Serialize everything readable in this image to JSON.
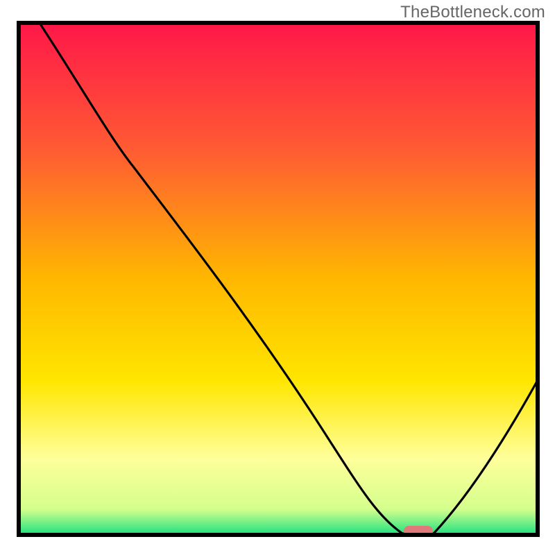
{
  "watermark": "TheBottleneck.com",
  "chart_data": {
    "type": "line",
    "title": "",
    "xlabel": "",
    "ylabel": "",
    "x_range": [
      0,
      100
    ],
    "y_range": [
      0,
      100
    ],
    "background_gradient": [
      {
        "stop": 0.0,
        "color": "#ff1749"
      },
      {
        "stop": 0.25,
        "color": "#ff5c33"
      },
      {
        "stop": 0.5,
        "color": "#ffb700"
      },
      {
        "stop": 0.7,
        "color": "#ffe600"
      },
      {
        "stop": 0.85,
        "color": "#ffff9a"
      },
      {
        "stop": 0.95,
        "color": "#d4ff8d"
      },
      {
        "stop": 1.0,
        "color": "#1be080"
      }
    ],
    "series": [
      {
        "name": "bottleneck-curve",
        "color": "#000000",
        "points": [
          {
            "x": 4,
            "y": 100
          },
          {
            "x": 22,
            "y": 72
          },
          {
            "x": 40,
            "y": 47
          },
          {
            "x": 60,
            "y": 18
          },
          {
            "x": 70,
            "y": 3
          },
          {
            "x": 74,
            "y": 0
          },
          {
            "x": 80,
            "y": 0
          },
          {
            "x": 100,
            "y": 30
          }
        ]
      }
    ],
    "marker": {
      "name": "optimal-point",
      "x": 77,
      "y": 0,
      "color": "#e07a7a",
      "shape": "rounded-bar"
    },
    "plot_border_color": "#000000",
    "plot_border_width": 6
  }
}
